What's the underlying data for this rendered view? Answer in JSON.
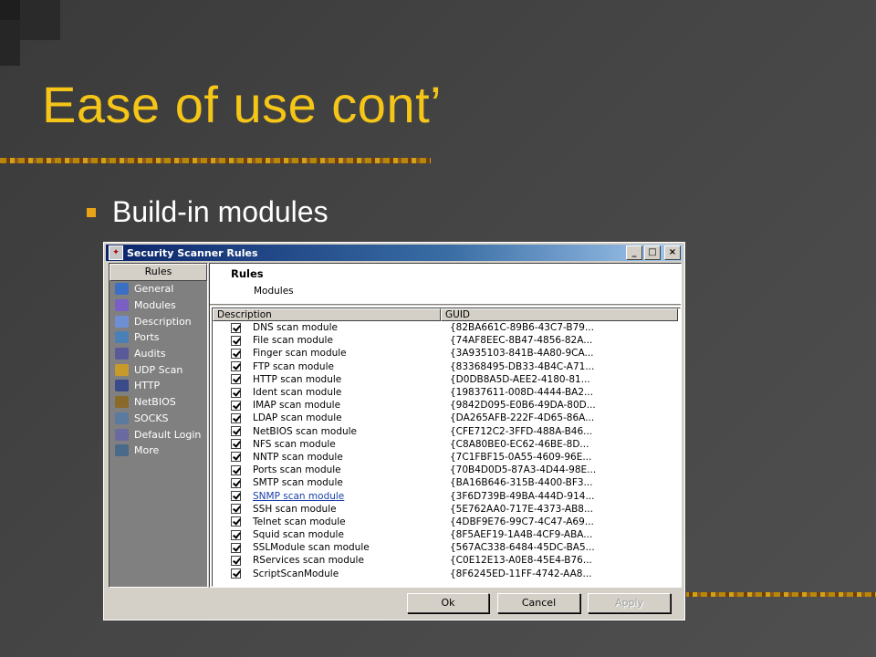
{
  "slide": {
    "title": "Ease of use cont’",
    "bullet": "Build-in modules"
  },
  "window": {
    "title": "Security Scanner Rules",
    "controls": [
      "_",
      "□",
      "×"
    ]
  },
  "sidebar": {
    "header": "Rules",
    "items": [
      {
        "label": "General",
        "icon": "general-icon",
        "color": "#3b6fc4"
      },
      {
        "label": "Modules",
        "icon": "modules-icon",
        "color": "#7a5fc4"
      },
      {
        "label": "Description",
        "icon": "description-icon",
        "color": "#6f8fd4"
      },
      {
        "label": "Ports",
        "icon": "ports-icon",
        "color": "#4a7fb8"
      },
      {
        "label": "Audits",
        "icon": "audits-icon",
        "color": "#5a5a9a"
      },
      {
        "label": "UDP Scan",
        "icon": "udp-scan-icon",
        "color": "#c89a2a"
      },
      {
        "label": "HTTP",
        "icon": "http-icon",
        "color": "#3a4a8a"
      },
      {
        "label": "NetBIOS",
        "icon": "netbios-icon",
        "color": "#8a6a2a"
      },
      {
        "label": "SOCKS",
        "icon": "socks-icon",
        "color": "#5a7aa0"
      },
      {
        "label": "Default Login",
        "icon": "default-login-icon",
        "color": "#6a6aa0"
      },
      {
        "label": "More",
        "icon": "more-icon",
        "color": "#4a6a8a"
      }
    ]
  },
  "panel": {
    "title": "Rules",
    "subtitle": "Modules"
  },
  "table": {
    "columns": [
      "Description",
      "GUID"
    ],
    "rows": [
      {
        "desc": "DNS scan module",
        "guid": "{82BA661C-89B6-43C7-B79..."
      },
      {
        "desc": "File scan module",
        "guid": "{74AF8EEC-8B47-4856-82A..."
      },
      {
        "desc": "Finger scan module",
        "guid": "{3A935103-841B-4A80-9CA..."
      },
      {
        "desc": "FTP scan module",
        "guid": "{83368495-DB33-4B4C-A71..."
      },
      {
        "desc": "HTTP scan module",
        "guid": "{D0DB8A5D-AEE2-4180-81..."
      },
      {
        "desc": "Ident scan module",
        "guid": "{19837611-008D-4444-BA2..."
      },
      {
        "desc": "IMAP scan module",
        "guid": "{9842D095-E0B6-49DA-80D..."
      },
      {
        "desc": "LDAP scan module",
        "guid": "{DA265AFB-222F-4D65-86A..."
      },
      {
        "desc": "NetBIOS scan module",
        "guid": "{CFE712C2-3FFD-488A-B46..."
      },
      {
        "desc": "NFS scan module",
        "guid": "{C8A80BE0-EC62-46BE-8D..."
      },
      {
        "desc": "NNTP scan module",
        "guid": "{7C1FBF15-0A55-4609-96E..."
      },
      {
        "desc": "Ports scan module",
        "guid": "{70B4D0D5-87A3-4D44-98E..."
      },
      {
        "desc": "SMTP scan module",
        "guid": "{BA16B646-315B-4400-BF3..."
      },
      {
        "desc": "SNMP scan module",
        "guid": "{3F6D739B-49BA-444D-914..."
      },
      {
        "desc": "SSH scan module",
        "guid": "{5E762AA0-717E-4373-AB8..."
      },
      {
        "desc": "Telnet scan module",
        "guid": "{4DBF9E76-99C7-4C47-A69..."
      },
      {
        "desc": "Squid scan module",
        "guid": "{8F5AEF19-1A4B-4CF9-ABA..."
      },
      {
        "desc": "SSLModule scan module",
        "guid": "{567AC338-6484-45DC-BA5..."
      },
      {
        "desc": "RServices scan module",
        "guid": "{C0E12E13-A0E8-45E4-B76..."
      },
      {
        "desc": "ScriptScanModule",
        "guid": "{8F6245ED-11FF-4742-AA8..."
      }
    ]
  },
  "buttons": {
    "ok": "Ok",
    "cancel": "Cancel",
    "apply": "Apply"
  },
  "colors": {
    "title": "#f5c518",
    "bullet": "#e8a317",
    "titlebar_start": "#0a246a",
    "titlebar_end": "#a6caf0",
    "link": "#1a3ea8"
  }
}
